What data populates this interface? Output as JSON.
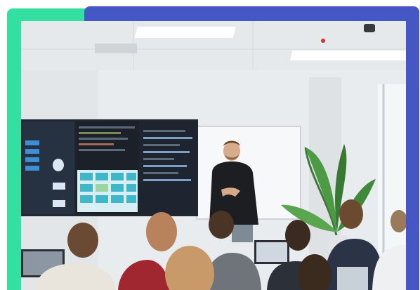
{
  "image": {
    "subject": "presenter-in-classroom-photo",
    "frame_colors": {
      "accent_green": "#34e0a1",
      "accent_blue": "#4557c4"
    }
  }
}
